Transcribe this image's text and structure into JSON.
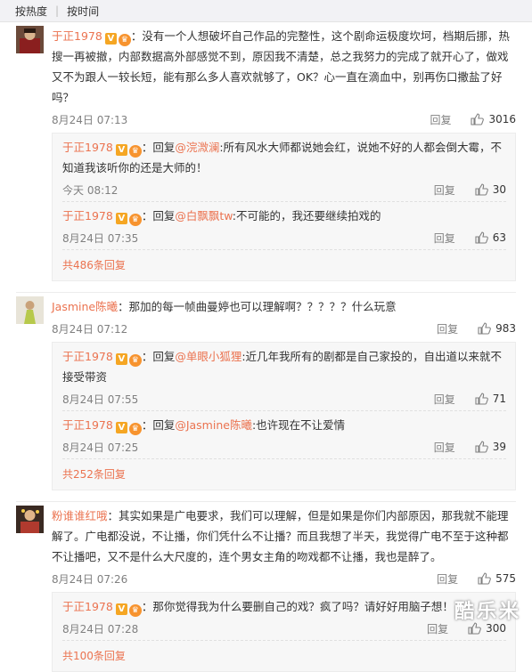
{
  "tabs": {
    "hot": "按热度",
    "time": "按时间"
  },
  "icons": {
    "verified": "verified-v-icon",
    "vip": "vip-crown-icon",
    "like": "thumbs-up-icon"
  },
  "colors": {
    "name": "#eb7350",
    "meta": "#808080",
    "reply_bg": "#f7f7f7"
  },
  "comments": [
    {
      "user": "于正1978",
      "text": "：没有一个人想破坏自己作品的完整性，这个剧命运极度坎坷，档期后挪，热搜一再被撤，内部数据高外部感觉不到，原因我不清楚，总之我努力的完成了就开心了，做戏又不为跟人一较长短，能有那么多人喜欢就够了，OK？心一直在滴血中，别再伤口撒盐了好吗？",
      "time": "8月24日 07:13",
      "reply": "回复",
      "likes": "3016",
      "replies": [
        {
          "user": "于正1978",
          "prefix": "：回复",
          "target": "@浣溦澜",
          "text": ":所有风水大师都说她会红，说她不好的人都会倒大霉，不知道我该听你的还是大师的！",
          "time": "今天 08:12",
          "reply": "回复",
          "likes": "30"
        },
        {
          "user": "于正1978",
          "prefix": "：回复",
          "target": "@白飘飘tw",
          "text": ":不可能的，我还要继续拍戏的",
          "time": "8月24日 07:35",
          "reply": "回复",
          "likes": "63"
        }
      ],
      "more": "共486条回复"
    },
    {
      "user": "Jasmine陈曦",
      "text": "：那加的每一帧曲曼婷也可以理解啊？？？？？什么玩意",
      "time": "8月24日 07:12",
      "reply": "回复",
      "likes": "983",
      "replies": [
        {
          "user": "于正1978",
          "prefix": "：回复",
          "target": "@单眼小狐狸",
          "text": ":近几年我所有的剧都是自己家投的，自出道以来就不接受带资",
          "time": "8月24日 07:55",
          "reply": "回复",
          "likes": "71"
        },
        {
          "user": "于正1978",
          "prefix": "：回复",
          "target": "@Jasmine陈曦",
          "text": ":也许现在不让爱情",
          "time": "8月24日 07:25",
          "reply": "回复",
          "likes": "39"
        }
      ],
      "more": "共252条回复"
    },
    {
      "user": "粉谁谁红哦",
      "text": "：其实如果是广电要求，我们可以理解，但是如果是你们内部原因，那我就不能理解了。广电都没说，不让播，你们凭什么不让播？而且我想了半天，我觉得广电不至于这种都不让播吧，又不是什么大尺度的，连个男女主角的吻戏都不让播，我也是醉了。",
      "time": "8月24日 07:26",
      "reply": "回复",
      "likes": "575",
      "replies": [
        {
          "user": "于正1978",
          "prefix": "：",
          "target": "",
          "text": "那你觉得我为什么要删自己的戏？疯了吗？请好好用脑子想！",
          "time": "8月24日 07:28",
          "reply": "回复",
          "likes": "300"
        }
      ],
      "more": "共100条回复"
    }
  ],
  "watermark": "酷乐米"
}
